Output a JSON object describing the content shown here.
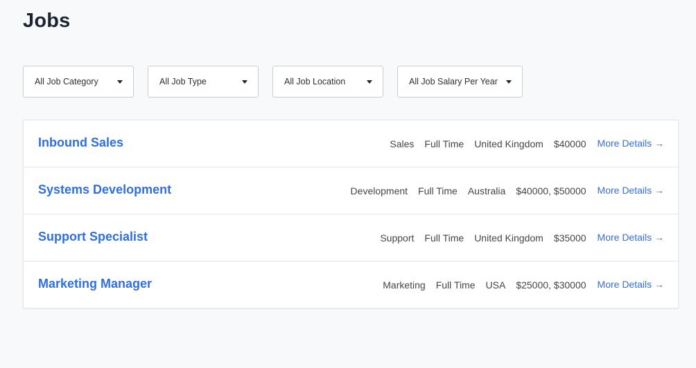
{
  "page": {
    "title": "Jobs"
  },
  "filters": [
    {
      "label": "All Job Category",
      "name": "filter-job-category"
    },
    {
      "label": "All Job Type",
      "name": "filter-job-type"
    },
    {
      "label": "All Job Location",
      "name": "filter-job-location"
    },
    {
      "label": "All Job Salary Per Year",
      "name": "filter-job-salary"
    }
  ],
  "jobs": [
    {
      "title": "Inbound Sales",
      "category": "Sales",
      "type": "Full Time",
      "location": "United Kingdom",
      "salary": "$40000",
      "link": "More Details →"
    },
    {
      "title": "Systems Development",
      "category": "Development",
      "type": "Full Time",
      "location": "Australia",
      "salary": "$40000, $50000",
      "link": "More Details →"
    },
    {
      "title": "Support Specialist",
      "category": "Support",
      "type": "Full Time",
      "location": "United Kingdom",
      "salary": "$35000",
      "link": "More Details →"
    },
    {
      "title": "Marketing Manager",
      "category": "Marketing",
      "type": "Full Time",
      "location": "USA",
      "salary": "$25000, $30000",
      "link": "More Details →"
    }
  ],
  "colors": {
    "background": "#f8f9fb",
    "title": "#1c2331",
    "link": "#2f6fe0",
    "meta_text": "#454545",
    "border": "#e2e4e8"
  },
  "icons": {
    "dropdown": "caret-down-icon"
  }
}
